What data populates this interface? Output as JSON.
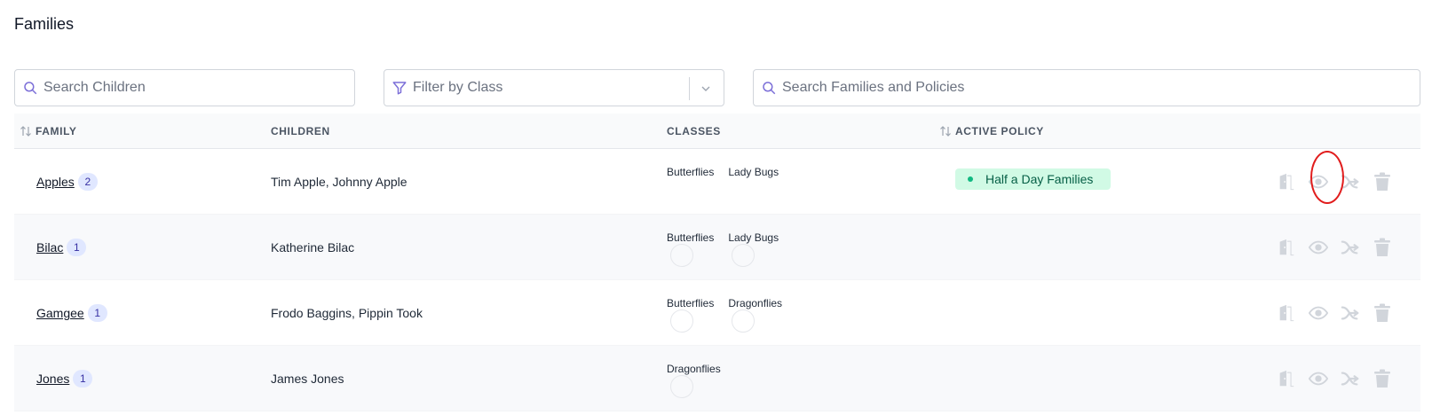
{
  "page": {
    "title": "Families"
  },
  "filters": {
    "children_search_placeholder": "Search Children",
    "class_filter_placeholder": "Filter by Class",
    "family_search_placeholder": "Search Families and Policies"
  },
  "table": {
    "headers": {
      "family": "FAMILY",
      "children": "CHILDREN",
      "classes": "CLASSES",
      "active_policy": "ACTIVE POLICY"
    },
    "rows": [
      {
        "family": "Apples",
        "count": "2",
        "children": "Tim Apple, Johnny Apple",
        "classes": [
          "Butterflies",
          "Lady Bugs"
        ],
        "policy": "Half a Day Families"
      },
      {
        "family": "Bilac",
        "count": "1",
        "children": "Katherine Bilac",
        "classes": [
          "Butterflies",
          "Lady Bugs"
        ],
        "policy": ""
      },
      {
        "family": "Gamgee",
        "count": "1",
        "children": "Frodo Baggins, Pippin Took",
        "classes": [
          "Butterflies",
          "Dragonflies"
        ],
        "policy": ""
      },
      {
        "family": "Jones",
        "count": "1",
        "children": "James Jones",
        "classes": [
          "Dragonflies"
        ],
        "policy": ""
      }
    ]
  },
  "icons": {
    "search": "search-icon",
    "filter": "filter-icon",
    "chevron": "chevron-down-icon",
    "sort": "sort-icon",
    "door": "door-icon",
    "view": "eye-icon",
    "move": "arrow-out-icon",
    "delete": "trash-icon"
  },
  "colors": {
    "accent": "#7c6fd8",
    "policy_bg": "#d1fae5",
    "policy_text": "#065f46",
    "badge_bg": "#e0e7ff",
    "action_icon": "#d1d5db",
    "highlight": "#e11d1d"
  }
}
